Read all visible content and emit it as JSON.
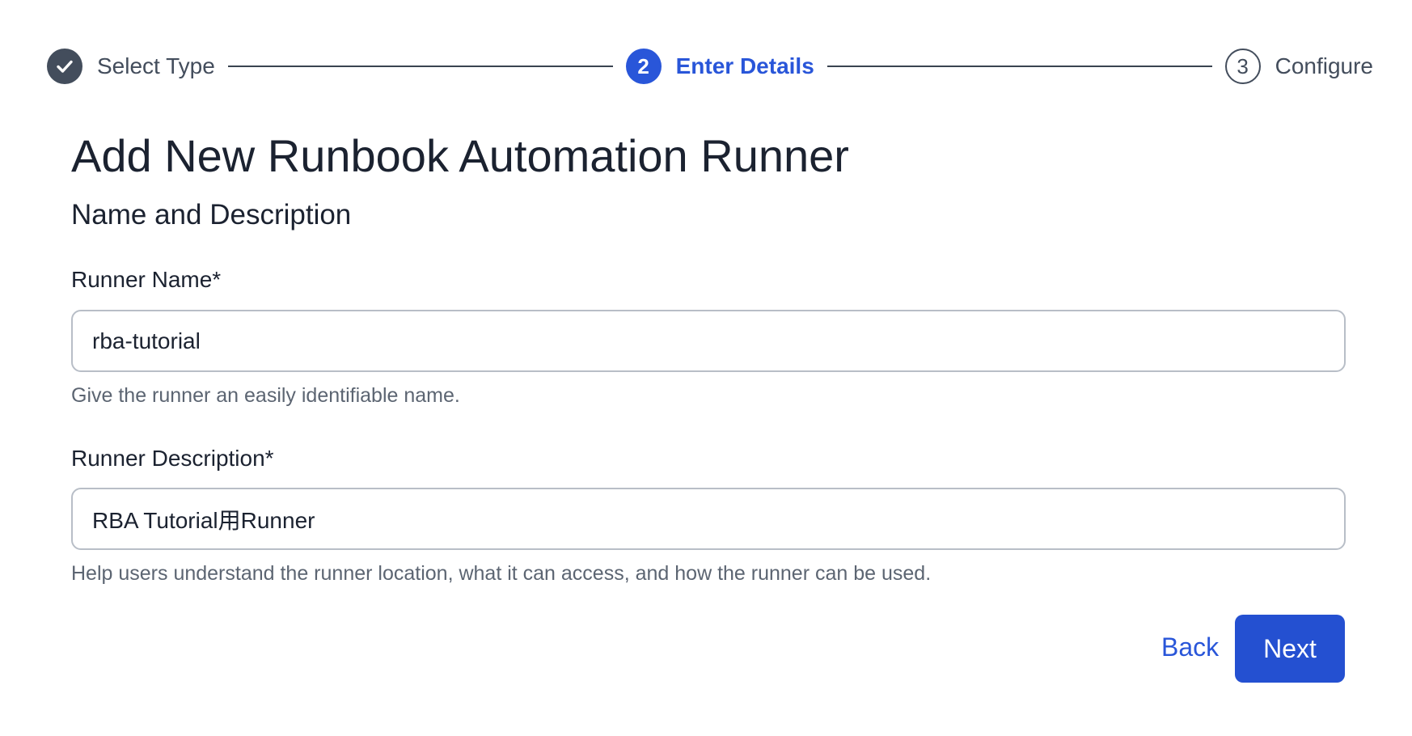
{
  "stepper": {
    "steps": [
      {
        "number": "",
        "label": "Select Type",
        "state": "completed",
        "icon": "checkmark-icon"
      },
      {
        "number": "2",
        "label": "Enter Details",
        "state": "active"
      },
      {
        "number": "3",
        "label": "Configure",
        "state": "pending"
      }
    ]
  },
  "page": {
    "title": "Add New Runbook Automation Runner",
    "section_title": "Name and Description"
  },
  "form": {
    "name": {
      "label": "Runner Name*",
      "value": "rba-tutorial",
      "help": "Give the runner an easily identifiable name."
    },
    "description": {
      "label": "Runner Description*",
      "value": "RBA Tutorial用Runner",
      "help": "Help users understand the runner location, what it can access, and how the runner can be used."
    }
  },
  "actions": {
    "back_label": "Back",
    "next_label": "Next"
  },
  "colors": {
    "accent": "#2956d9",
    "completed": "#434d5c",
    "primary_button": "#2450d1"
  }
}
